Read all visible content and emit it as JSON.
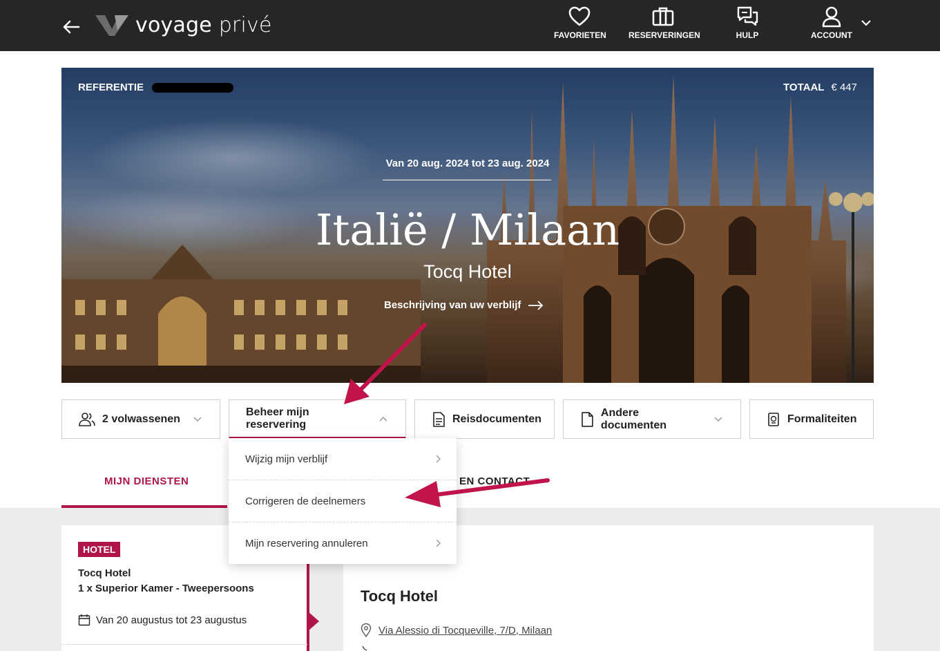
{
  "header": {
    "logo_text_bold": "voyage",
    "logo_text_light": " privé",
    "nav": [
      {
        "label": "FAVORIETEN",
        "icon": "heart-icon"
      },
      {
        "label": "RESERVERINGEN",
        "icon": "suitcase-icon"
      },
      {
        "label": "HULP",
        "icon": "chat-icon"
      },
      {
        "label": "ACCOUNT",
        "icon": "user-icon"
      }
    ]
  },
  "hero": {
    "reference_label": "REFERENTIE",
    "total_label": "TOTAAL",
    "total_value": "€ 447",
    "dates": "Van 20 aug. 2024 tot 23 aug. 2024",
    "title": "Italië / Milaan",
    "subtitle": "Tocq Hotel",
    "link": "Beschrijving van uw verblijf"
  },
  "actions": {
    "guests": "2 volwassenen",
    "manage": "Beheer mijn reservering",
    "travel_docs": "Reisdocumenten",
    "other_docs": "Andere documenten",
    "formalities": "Formaliteiten"
  },
  "dropdown": {
    "items": [
      "Wijzig mijn verblijf",
      "Corrigeren de deelnemers",
      "Mijn reservering annuleren"
    ]
  },
  "tabs": {
    "services": "MIJN DIENSTEN",
    "contact": "EN CONTACT"
  },
  "booking": {
    "badge": "HOTEL",
    "hotel_name": "Tocq Hotel",
    "room": "1 x Superior Kamer - Tweepersoons",
    "dates": "Van 20 augustus tot 23 augustus",
    "detail_title": "Tocq Hotel",
    "address": "Via Alessio di Tocqueville, 7/D, Milaan"
  },
  "colors": {
    "accent": "#b0154a",
    "topbar": "#262626",
    "annotation_arrow": "#c0144a"
  }
}
